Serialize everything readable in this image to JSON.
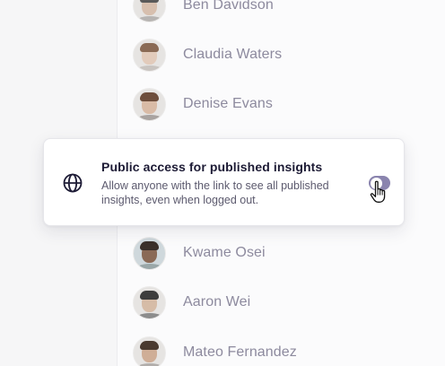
{
  "people": [
    {
      "name": "Ben Davidson"
    },
    {
      "name": "Claudia Waters"
    },
    {
      "name": "Denise Evans"
    },
    {
      "name": "Kwame Osei"
    },
    {
      "name": "Aaron Wei"
    },
    {
      "name": "Mateo Fernandez"
    }
  ],
  "setting": {
    "icon": "globe-icon",
    "title": "Public access for published insights",
    "description": "Allow anyone with the link to see all published insights, even when logged out.",
    "toggle_on": false
  },
  "colors": {
    "accent": "#8a84ae",
    "title": "#1d1b35",
    "muted_name": "#8d8a9e"
  }
}
